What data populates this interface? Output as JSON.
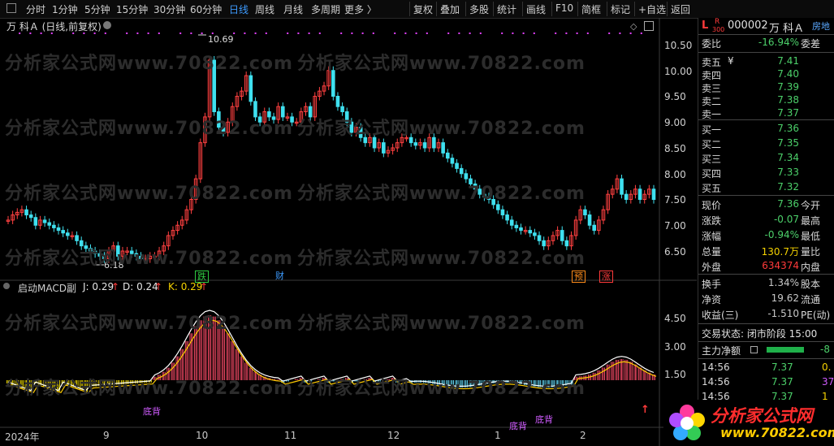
{
  "toolbar": {
    "left_items": [
      "分时",
      "1分钟",
      "5分钟",
      "15分钟",
      "30分钟",
      "60分钟",
      "日线",
      "周线",
      "月线",
      "多周期",
      "更多 〉"
    ],
    "active": "日线",
    "right_items": [
      "复权",
      "叠加",
      "多股",
      "统计",
      "画线",
      "F10",
      "简框",
      "标记",
      "+自选",
      "返回"
    ]
  },
  "chart": {
    "title": "万 科Ａ (日线,前复权)",
    "high_label": "10.69",
    "low_label": "6.18",
    "price_ticks": [
      "10.50",
      "10.00",
      "9.50",
      "9.00",
      "8.50",
      "8.00",
      "7.50",
      "7.00",
      "6.50"
    ],
    "event_tags": [
      {
        "text": "跌",
        "color": "#2ecc40"
      },
      {
        "text": "财",
        "color": "#3d9bff"
      },
      {
        "text": "预",
        "color": "#ff8c1a"
      },
      {
        "text": "涨",
        "color": "#ff3a3a"
      }
    ],
    "watermark": "分析家公式网www.70822.com",
    "indicator": {
      "name": "启动MACD副",
      "j": "J: 0.29",
      "d": "D: 0.24",
      "k": "K: 0.29",
      "ticks": [
        "4.50",
        "3.00",
        "1.50"
      ],
      "labels": [
        "底背",
        "底背",
        "底背"
      ]
    },
    "x_labels": [
      "2024年",
      "9",
      "10",
      "11",
      "12",
      "1",
      "2"
    ]
  },
  "panel": {
    "market": "L",
    "tag_r": "R",
    "tag_300": "300",
    "code": "000002",
    "name": "万 科Ａ",
    "short": "房地",
    "weibi": {
      "label": "委比",
      "value": "-16.94%",
      "right": "委差"
    },
    "sells": [
      {
        "label": "卖五",
        "sym": "¥",
        "price": "7.41"
      },
      {
        "label": "卖四",
        "sym": "",
        "price": "7.40"
      },
      {
        "label": "卖三",
        "sym": "",
        "price": "7.39"
      },
      {
        "label": "卖二",
        "sym": "",
        "price": "7.38"
      },
      {
        "label": "卖一",
        "sym": "",
        "price": "7.37"
      }
    ],
    "buys": [
      {
        "label": "买一",
        "price": "7.36"
      },
      {
        "label": "买二",
        "price": "7.35"
      },
      {
        "label": "买三",
        "price": "7.34"
      },
      {
        "label": "买四",
        "price": "7.33"
      },
      {
        "label": "买五",
        "price": "7.32"
      }
    ],
    "stats": [
      {
        "k": "现价",
        "v": "7.36",
        "k2": "今开",
        "color": "green"
      },
      {
        "k": "涨跌",
        "v": "-0.07",
        "k2": "最高",
        "color": "green"
      },
      {
        "k": "涨幅",
        "v": "-0.94%",
        "k2": "最低",
        "color": "green"
      },
      {
        "k": "总量",
        "v": "130.7万",
        "k2": "量比",
        "color": "yellow"
      },
      {
        "k": "外盘",
        "v": "634374",
        "k2": "内盘",
        "color": "red"
      }
    ],
    "stats2": [
      {
        "k": "换手",
        "v": "1.34%",
        "k2": "股本"
      },
      {
        "k": "净资",
        "v": "19.62",
        "k2": "流通"
      },
      {
        "k": "收益(三)",
        "v": "-1.510",
        "k2": "PE(动)"
      }
    ],
    "trade_status": "交易状态: 闭市阶段 15:00",
    "main_flow": {
      "label": "主力净额",
      "value": "-8"
    },
    "ticks": [
      {
        "time": "14:56",
        "price": "7.37",
        "vol": "0."
      },
      {
        "time": "14:56",
        "price": "7.37",
        "vol": "37"
      },
      {
        "time": "14:56",
        "price": "7.37",
        "vol": "1"
      }
    ]
  },
  "logo": {
    "text": "分析家公式网",
    "url": "www.70822.com"
  }
}
